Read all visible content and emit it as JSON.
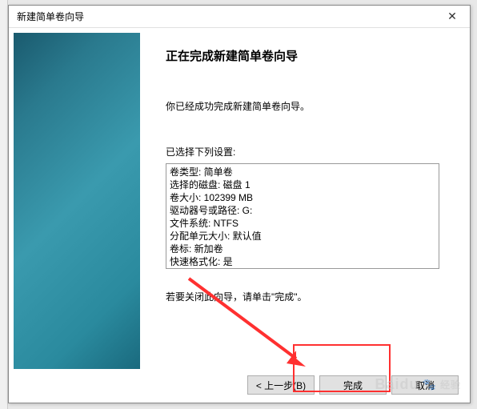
{
  "window": {
    "title": "新建简单卷向导"
  },
  "heading": "正在完成新建简单卷向导",
  "intro": "你已经成功完成新建简单卷向导。",
  "settings_label": "已选择下列设置:",
  "settings": {
    "volume_type": "卷类型: 简单卷",
    "disk_selected": "选择的磁盘: 磁盘 1",
    "volume_size": "卷大小: 102399 MB",
    "drive_letter": "驱动器号或路径: G:",
    "file_system": "文件系统: NTFS",
    "allocation_unit": "分配单元大小: 默认值",
    "volume_label": "卷标: 新加卷",
    "quick_format": "快速格式化: 是"
  },
  "close_hint": "若要关闭此向导，请单击\"完成\"。",
  "buttons": {
    "back": "< 上一步(B)",
    "finish": "完成",
    "cancel": "取消"
  },
  "watermark": {
    "text": "Baidu",
    "sub": "经验"
  },
  "annotation": {
    "highlight_color": "#ff3030",
    "arrow_color": "#ff3030"
  }
}
